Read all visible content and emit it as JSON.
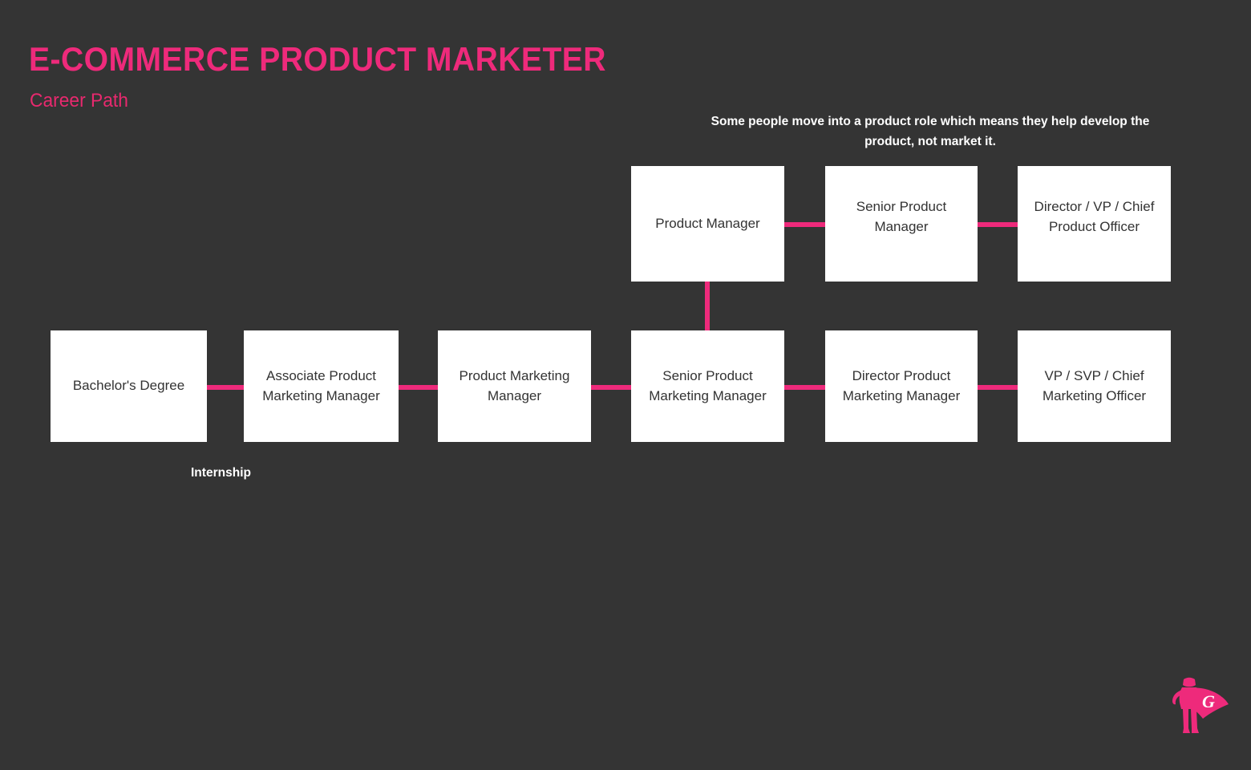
{
  "theme": {
    "background": "#343434",
    "accent_pink": "#EE2A7B",
    "box_fill": "#FFFFFF",
    "box_text": "#333333",
    "annotation_text": "#FFFFFF"
  },
  "header": {
    "title": "E-Commerce Product Marketer",
    "subtitle": "Career Path"
  },
  "annotation": {
    "text": "Some people move into a product role which means they help develop the product, not market it."
  },
  "labels": {
    "internship": "Internship"
  },
  "logo": {
    "name": "superhero-logo",
    "letter": "G"
  },
  "chart_data": {
    "type": "diagram",
    "title": "E-Commerce Product Marketer Career Path",
    "nodes": [
      {
        "id": "bachelors",
        "label": "Bachelor's Degree",
        "row": "bottom",
        "order": 1
      },
      {
        "id": "assoc-pmm",
        "label": "Associate Product\nMarketing Manager",
        "row": "bottom",
        "order": 2
      },
      {
        "id": "pmm",
        "label": "Product Marketing\nManager",
        "row": "bottom",
        "order": 3
      },
      {
        "id": "senior-pmm",
        "label": "Senior Product\nMarketing Manager",
        "row": "bottom",
        "order": 4
      },
      {
        "id": "director-pmm",
        "label": "Director Product\nMarketing Manager",
        "row": "bottom",
        "order": 5
      },
      {
        "id": "vp-svp-cmo",
        "label": "VP / SVP / Chief\nMarketing Officer",
        "row": "bottom",
        "order": 6
      },
      {
        "id": "product-manager",
        "label": "Product Manager",
        "row": "top",
        "order": 1
      },
      {
        "id": "senior-product-mgr",
        "label": "Senior Product\nManager",
        "row": "top",
        "order": 2
      },
      {
        "id": "director-vp-product",
        "label": "Director / VP / Chief\nProduct Officer",
        "row": "top",
        "order": 3
      }
    ],
    "edges": [
      {
        "from": "bachelors",
        "to": "assoc-pmm",
        "kind": "horizontal"
      },
      {
        "from": "assoc-pmm",
        "to": "pmm",
        "kind": "horizontal"
      },
      {
        "from": "pmm",
        "to": "senior-pmm",
        "kind": "horizontal"
      },
      {
        "from": "senior-pmm",
        "to": "director-pmm",
        "kind": "horizontal"
      },
      {
        "from": "director-pmm",
        "to": "vp-svp-cmo",
        "kind": "horizontal"
      },
      {
        "from": "senior-pmm",
        "to": "product-manager",
        "kind": "vertical"
      },
      {
        "from": "product-manager",
        "to": "senior-product-mgr",
        "kind": "horizontal"
      },
      {
        "from": "senior-product-mgr",
        "to": "director-vp-product",
        "kind": "horizontal"
      }
    ]
  }
}
